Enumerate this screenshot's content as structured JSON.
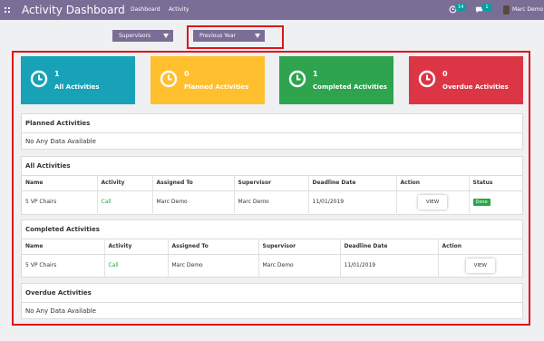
{
  "header": {
    "title": "Activity Dashboard",
    "nav": [
      "Dashboard",
      "Activity"
    ],
    "activity_badge": "14",
    "message_badge": "1",
    "user_name": "Marc Demo"
  },
  "filters": {
    "supervisor_label": "Supervisors",
    "period_label": "Previous Year"
  },
  "cards": [
    {
      "count": "1",
      "label": "All Activities",
      "color": "#17a2b8"
    },
    {
      "count": "0",
      "label": "Planned Activities",
      "color": "#ffbf2f"
    },
    {
      "count": "1",
      "label": "Completed Activities",
      "color": "#2ea44f"
    },
    {
      "count": "0",
      "label": "Overdue Activities",
      "color": "#dc3545"
    }
  ],
  "planned": {
    "title": "Planned Activities",
    "empty_text": "No Any Data Available"
  },
  "all": {
    "title": "All Activities",
    "columns": [
      "Name",
      "Activity",
      "Assigned To",
      "Supervisor",
      "Deadline Date",
      "Action",
      "Status"
    ],
    "rows": [
      {
        "name": "5 VP Chairs",
        "activity": "Call",
        "assigned_to": "Marc Demo",
        "supervisor": "Marc Demo",
        "deadline": "11/01/2019",
        "action": "VIEW",
        "status": "Done"
      }
    ]
  },
  "completed": {
    "title": "Completed Activities",
    "columns": [
      "Name",
      "Activity",
      "Assigned To",
      "Supervisor",
      "Deadline Date",
      "Action"
    ],
    "rows": [
      {
        "name": "5 VP Chairs",
        "activity": "Call",
        "assigned_to": "Marc Demo",
        "supervisor": "Marc Demo",
        "deadline": "11/01/2019",
        "action": "VIEW"
      }
    ]
  },
  "overdue": {
    "title": "Overdue Activities",
    "empty_text": "No Any Data Available"
  }
}
